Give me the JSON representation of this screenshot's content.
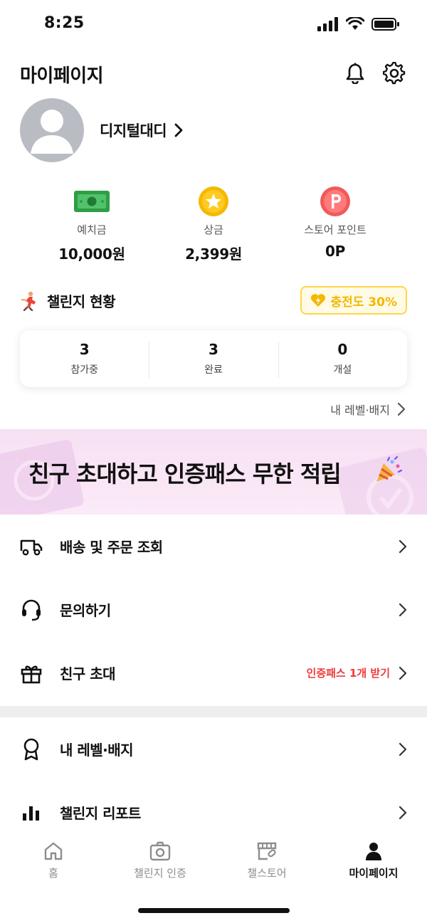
{
  "status": {
    "time": "8:25"
  },
  "header": {
    "title": "마이페이지"
  },
  "profile": {
    "nickname": "디지털대디"
  },
  "stats": [
    {
      "label": "예치금",
      "value": "10,000원",
      "icon": "cash-icon"
    },
    {
      "label": "상금",
      "value": "2,399원",
      "icon": "star-coin-icon"
    },
    {
      "label": "스토어 포인트",
      "value": "0P",
      "icon": "point-coin-icon"
    }
  ],
  "challenge": {
    "title": "챌린지 현황",
    "charge_label": "충전도 30%",
    "counts": [
      {
        "num": "3",
        "label": "참가중"
      },
      {
        "num": "3",
        "label": "완료"
      },
      {
        "num": "0",
        "label": "개설"
      }
    ],
    "level_link": "내 레벨·배지"
  },
  "banner": {
    "text": "친구 초대하고 인증패스 무한 적립"
  },
  "menu_top": [
    {
      "label": "배송 및 주문 조회",
      "icon": "truck-icon"
    },
    {
      "label": "문의하기",
      "icon": "headset-icon"
    },
    {
      "label": "친구 초대",
      "icon": "gift-icon",
      "extra": "인증패스 1개 받기"
    }
  ],
  "menu_bottom": [
    {
      "label": "내 레벨·배지",
      "icon": "badge-icon"
    },
    {
      "label": "챌린지 리포트",
      "icon": "bar-chart-icon"
    }
  ],
  "tabs": [
    {
      "label": "홈",
      "icon": "home-icon"
    },
    {
      "label": "챌린지 인증",
      "icon": "camera-icon"
    },
    {
      "label": "챌스토어",
      "icon": "store-icon"
    },
    {
      "label": "마이페이지",
      "icon": "person-icon",
      "active": true
    }
  ],
  "colors": {
    "accent_yellow": "#f3b800",
    "alert_red": "#ef3b3b",
    "banner_pink": "#f6e1f3"
  }
}
